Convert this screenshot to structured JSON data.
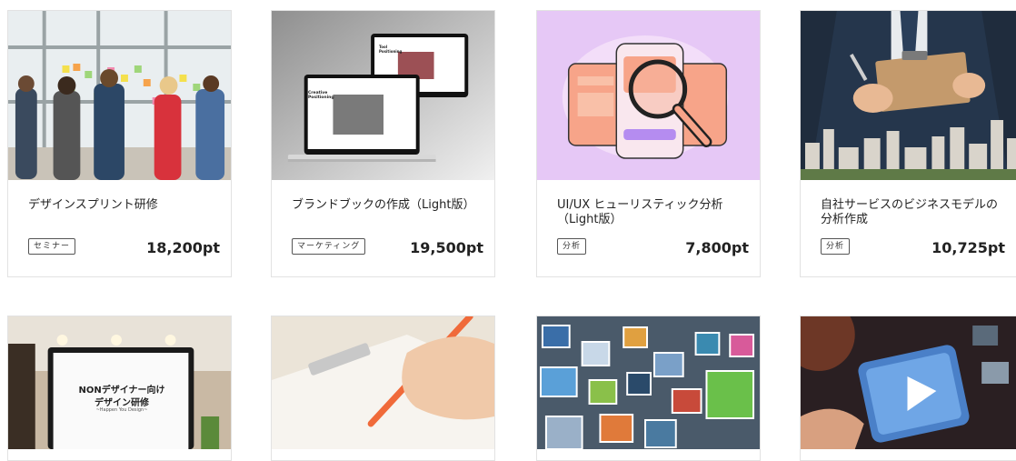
{
  "cards": [
    {
      "title": "デザインスプリント研修",
      "tag": "セミナー",
      "price": "18,200pt",
      "image": "workshop-photo"
    },
    {
      "title": "ブランドブックの作成（Light版）",
      "tag": "マーケティング",
      "price": "19,500pt",
      "image": "laptop-mockup",
      "screen_text_1": "Creative Positioning",
      "screen_text_2": "Tool Positioning"
    },
    {
      "title": "UI/UX ヒューリスティック分析（Light版）",
      "tag": "分析",
      "price": "7,800pt",
      "image": "magnifier-illustration"
    },
    {
      "title": "自社サービスのビジネスモデルの分析作成",
      "tag": "分析",
      "price": "10,725pt",
      "image": "businessman-clipboard"
    },
    {
      "image": "laptop-slide",
      "screen_text_1": "NONデザイナー向け",
      "screen_text_2": "デザイン研修",
      "screen_text_3": "~Happen You Design~"
    },
    {
      "image": "hand-writing"
    },
    {
      "image": "photo-collage"
    },
    {
      "image": "video-play-screen"
    }
  ],
  "colors": {
    "border": "#e2e2e2",
    "tag_border": "#555555",
    "text": "#222222"
  }
}
